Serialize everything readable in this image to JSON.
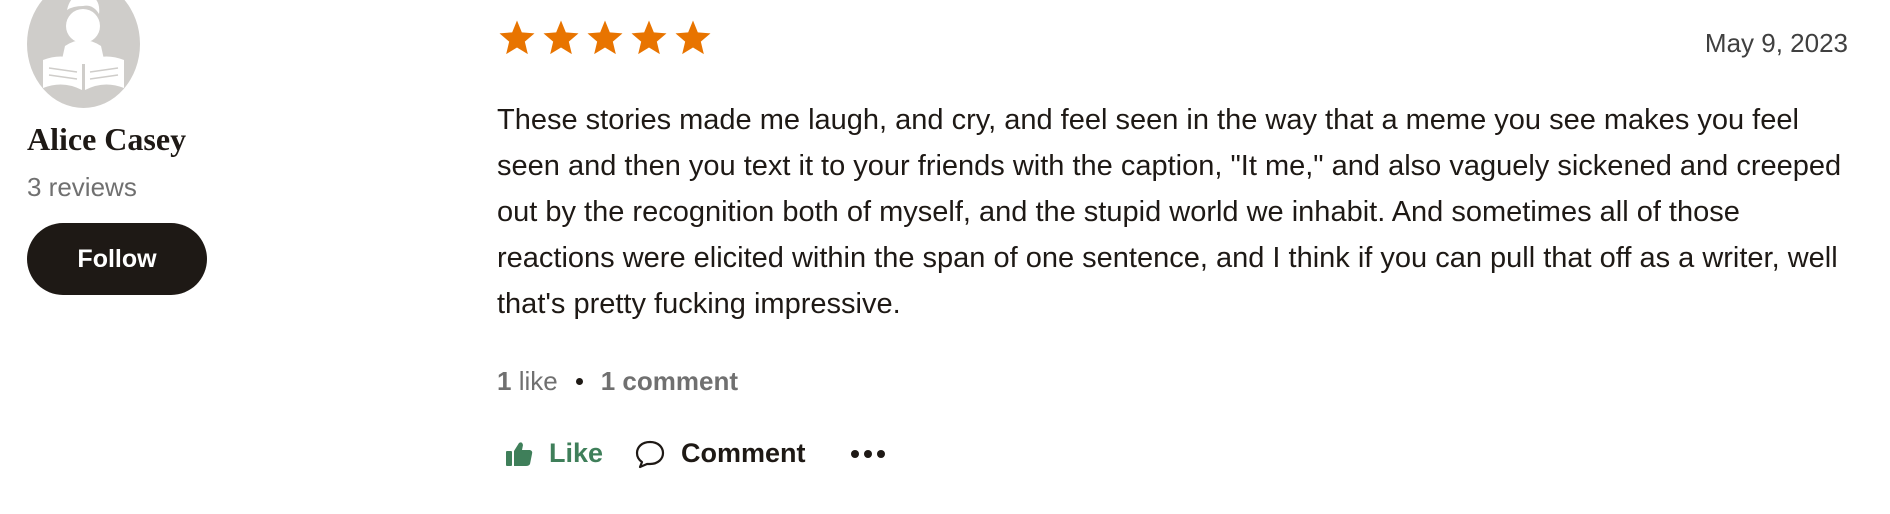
{
  "reviewer": {
    "name": "Alice Casey",
    "reviews_count": "3 reviews",
    "follow_label": "Follow",
    "avatar_icon": "reader-silhouette-icon"
  },
  "review": {
    "rating": 5,
    "rating_max": 5,
    "star_color": "#e87400",
    "date": "May 9, 2023",
    "text": "These stories made me laugh, and cry, and feel seen in the way that a meme you see makes you feel seen and then you text it to your friends with the caption, \"It me,\" and also vaguely sickened and creeped out by the recognition both of myself, and the stupid world we inhabit. And sometimes all of those reactions were elicited within the span of one sentence, and I think if you can pull that off as a writer, well that's pretty fucking impressive."
  },
  "stats": {
    "likes_count": "1",
    "likes_label": "like",
    "comments_count": "1",
    "comments_label": "comment"
  },
  "actions": {
    "like_label": "Like",
    "like_icon": "thumbs-up-icon",
    "like_color": "#3f7f5a",
    "comment_label": "Comment",
    "comment_icon": "speech-bubble-icon",
    "more_icon": "more-horizontal-icon"
  }
}
